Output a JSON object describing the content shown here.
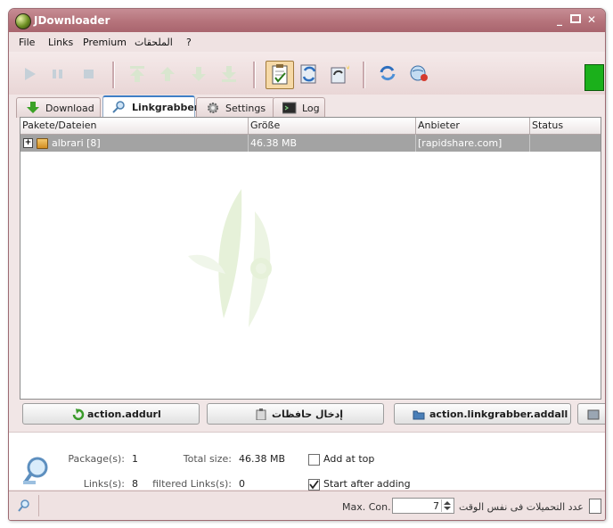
{
  "window": {
    "title": "JDownloader"
  },
  "menu": {
    "items": [
      "File",
      "Links",
      "Premium",
      "الملحقات",
      "?"
    ]
  },
  "toolbar": {
    "icons": [
      "play-icon",
      "pause-icon",
      "stop-icon",
      "move-top-icon",
      "move-up-icon",
      "move-down-icon",
      "move-bottom-icon",
      "clipboard-icon",
      "reconnect-icon",
      "update-icon",
      "refresh-icon",
      "premium-icon"
    ]
  },
  "tabs": [
    {
      "label": "Download",
      "icon": "download-arrow-icon"
    },
    {
      "label": "Linkgrabber",
      "icon": "magnifier-icon"
    },
    {
      "label": "Settings",
      "icon": "gear-icon"
    },
    {
      "label": "Log",
      "icon": "console-icon"
    }
  ],
  "table": {
    "columns": [
      "Pakete/Dateien",
      "Größe",
      "Anbieter",
      "Status"
    ],
    "rows": [
      {
        "expander": "+",
        "name": "albrari [8]",
        "size": "46.38 MB",
        "host": "[rapidshare.com]",
        "status": ""
      }
    ]
  },
  "actions": {
    "addurl": "action.addurl",
    "clipboard": "إدخال حافظات",
    "addall": "action.linkgrabber.addall"
  },
  "info": {
    "packages_label": "Package(s):",
    "packages_value": "1",
    "links_label": "Links(s):",
    "links_value": "8",
    "total_size_label": "Total size:",
    "total_size_value": "46.38 MB",
    "filtered_label": "filtered Links(s):",
    "filtered_value": "0",
    "add_at_top_label": "Add at top",
    "add_at_top_checked": false,
    "start_after_label": "Start after adding",
    "start_after_checked": true
  },
  "statusbar": {
    "max_con_label": "Max. Con.",
    "max_con_value": "7",
    "downloads_label": "عدد التحميلات فى نفس الوقت"
  },
  "colors": {
    "title_bar": "#b5737b",
    "selected_row": "#a3a3a3",
    "active_tab_border": "#3f7fc6",
    "connected_indicator": "#1bb01b"
  }
}
